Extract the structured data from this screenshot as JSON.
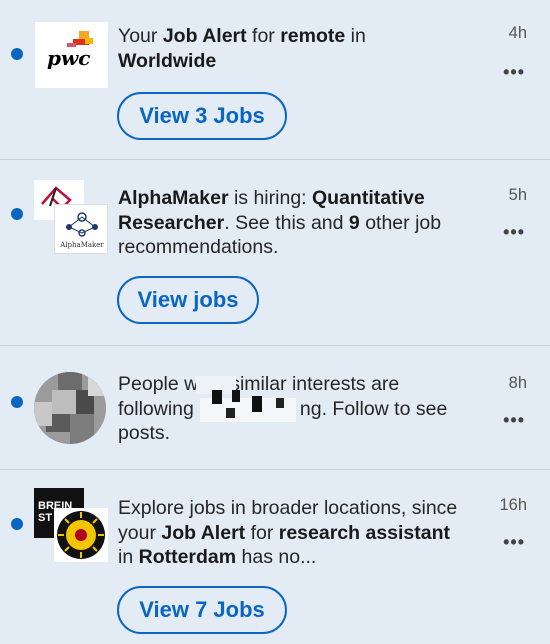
{
  "notifications": [
    {
      "logo": "PwC logo",
      "logo_text": "pwc",
      "text_parts": [
        {
          "t": "Your ",
          "b": false
        },
        {
          "t": "Job Alert",
          "b": true
        },
        {
          "t": " for ",
          "b": false
        },
        {
          "t": "remote",
          "b": true
        },
        {
          "t": " in ",
          "b": false
        },
        {
          "t": "Worldwide",
          "b": true
        }
      ],
      "time": "4h",
      "more": "•••",
      "button": "View 3 Jobs"
    },
    {
      "logo": "AlphaMaker logo",
      "logo_caption": "AlphaMaker",
      "text_parts": [
        {
          "t": "AlphaMaker",
          "b": true
        },
        {
          "t": " is hiring: ",
          "b": false
        },
        {
          "t": "Quantitative Researcher",
          "b": true
        },
        {
          "t": ". See this and ",
          "b": false
        },
        {
          "t": "9",
          "b": true
        },
        {
          "t": " other job recommendations.",
          "b": false
        }
      ],
      "time": "5h",
      "more": "•••",
      "button": "View jobs"
    },
    {
      "logo": "profile photo (blurred)",
      "text_line1": "People w",
      "text_line1b": "similar interests are",
      "text_line2": "following",
      "text_line2b": "ng. Follow to see",
      "text_line3": "posts.",
      "time": "8h",
      "more": "•••"
    },
    {
      "logo": "BREIN ST logo and university seal",
      "logo_text": "BREIN ST",
      "text_parts": [
        {
          "t": "Explore jobs in broader locations, since your ",
          "b": false
        },
        {
          "t": "Job Alert",
          "b": true
        },
        {
          "t": " for ",
          "b": false
        },
        {
          "t": "research assistant",
          "b": true
        },
        {
          "t": " in ",
          "b": false
        },
        {
          "t": "Rotterdam",
          "b": true
        },
        {
          "t": " has no...",
          "b": false
        }
      ],
      "time": "16h",
      "more": "•••",
      "button": "View 7 Jobs"
    }
  ],
  "colors": {
    "accent": "#0a66c2",
    "card_bg": "#e3ebf5",
    "unread_dot": "#0a66c2"
  }
}
